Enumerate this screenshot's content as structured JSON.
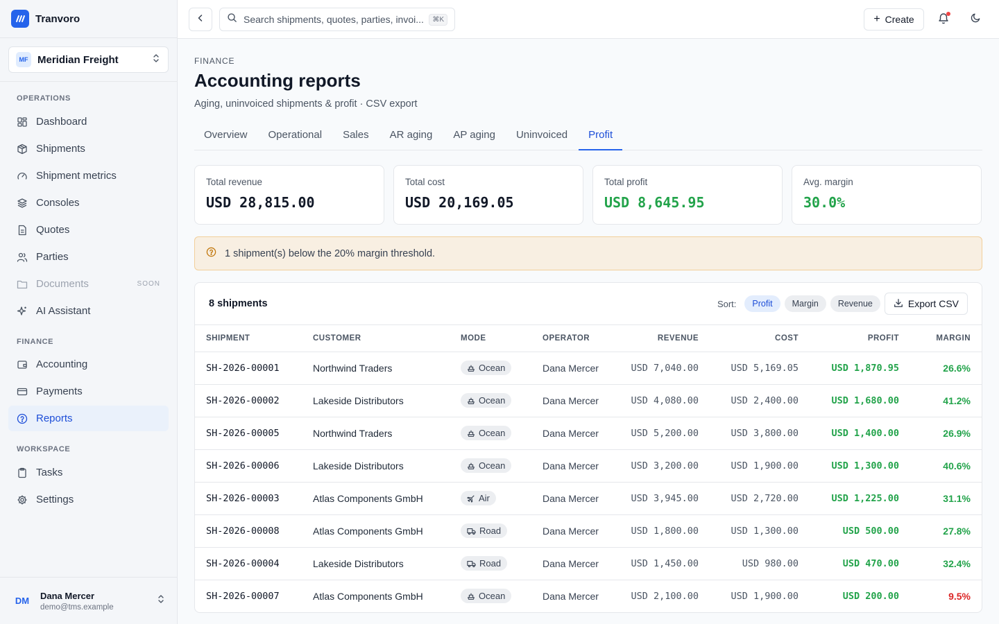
{
  "app": {
    "name": "Tranvoro"
  },
  "org": {
    "initials": "MF",
    "name": "Meridian Freight"
  },
  "sidebar": {
    "sections": [
      {
        "label": "OPERATIONS"
      },
      {
        "label": "FINANCE"
      },
      {
        "label": "WORKSPACE"
      }
    ],
    "items": [
      {
        "label": "Dashboard",
        "icon": "dashboard-icon"
      },
      {
        "label": "Shipments",
        "icon": "package-icon"
      },
      {
        "label": "Shipment metrics",
        "icon": "gauge-icon"
      },
      {
        "label": "Consoles",
        "icon": "layers-icon"
      },
      {
        "label": "Quotes",
        "icon": "document-icon"
      },
      {
        "label": "Parties",
        "icon": "users-icon"
      },
      {
        "label": "Documents",
        "icon": "folder-icon",
        "badge": "SOON"
      },
      {
        "label": "AI Assistant",
        "icon": "sparkles-icon"
      },
      {
        "label": "Accounting",
        "icon": "wallet-icon"
      },
      {
        "label": "Payments",
        "icon": "credit-card-icon"
      },
      {
        "label": "Reports",
        "icon": "help-circle-icon"
      },
      {
        "label": "Tasks",
        "icon": "clipboard-icon"
      },
      {
        "label": "Settings",
        "icon": "gear-icon"
      }
    ]
  },
  "user": {
    "initials": "DM",
    "name": "Dana Mercer",
    "email": "demo@tms.example"
  },
  "topbar": {
    "search_placeholder": "Search shipments, quotes, parties, invoi...",
    "search_shortcut": "⌘K",
    "create_label": "Create"
  },
  "page": {
    "eyebrow": "FINANCE",
    "title": "Accounting reports",
    "subtitle": "Aging, uninvoiced shipments & profit · CSV export",
    "tabs": [
      "Overview",
      "Operational",
      "Sales",
      "AR aging",
      "AP aging",
      "Uninvoiced",
      "Profit"
    ],
    "active_tab": "Profit"
  },
  "summary": [
    {
      "label": "Total revenue",
      "value": "USD 28,815.00"
    },
    {
      "label": "Total cost",
      "value": "USD 20,169.05"
    },
    {
      "label": "Total profit",
      "value": "USD 8,645.95"
    },
    {
      "label": "Avg. margin",
      "value": "30.0%"
    }
  ],
  "alert": {
    "text": "1 shipment(s) below the 20% margin threshold."
  },
  "table": {
    "count_label": "8 shipments",
    "sort_label": "Sort:",
    "sort_options": [
      "Profit",
      "Margin",
      "Revenue"
    ],
    "active_sort": "Profit",
    "export_label": "Export CSV",
    "columns": [
      "SHIPMENT",
      "CUSTOMER",
      "MODE",
      "OPERATOR",
      "REVENUE",
      "COST",
      "PROFIT",
      "MARGIN"
    ],
    "rows": [
      {
        "shipment": "SH-2026-00001",
        "customer": "Northwind Traders",
        "mode": "Ocean",
        "operator": "Dana Mercer",
        "revenue": "USD 7,040.00",
        "cost": "USD 5,169.05",
        "profit": "USD 1,870.95",
        "margin": "26.6%"
      },
      {
        "shipment": "SH-2026-00002",
        "customer": "Lakeside Distributors",
        "mode": "Ocean",
        "operator": "Dana Mercer",
        "revenue": "USD 4,080.00",
        "cost": "USD 2,400.00",
        "profit": "USD 1,680.00",
        "margin": "41.2%"
      },
      {
        "shipment": "SH-2026-00005",
        "customer": "Northwind Traders",
        "mode": "Ocean",
        "operator": "Dana Mercer",
        "revenue": "USD 5,200.00",
        "cost": "USD 3,800.00",
        "profit": "USD 1,400.00",
        "margin": "26.9%"
      },
      {
        "shipment": "SH-2026-00006",
        "customer": "Lakeside Distributors",
        "mode": "Ocean",
        "operator": "Dana Mercer",
        "revenue": "USD 3,200.00",
        "cost": "USD 1,900.00",
        "profit": "USD 1,300.00",
        "margin": "40.6%"
      },
      {
        "shipment": "SH-2026-00003",
        "customer": "Atlas Components GmbH",
        "mode": "Air",
        "operator": "Dana Mercer",
        "revenue": "USD 3,945.00",
        "cost": "USD 2,720.00",
        "profit": "USD 1,225.00",
        "margin": "31.1%"
      },
      {
        "shipment": "SH-2026-00008",
        "customer": "Atlas Components GmbH",
        "mode": "Road",
        "operator": "Dana Mercer",
        "revenue": "USD 1,800.00",
        "cost": "USD 1,300.00",
        "profit": "USD 500.00",
        "margin": "27.8%"
      },
      {
        "shipment": "SH-2026-00004",
        "customer": "Lakeside Distributors",
        "mode": "Road",
        "operator": "Dana Mercer",
        "revenue": "USD 1,450.00",
        "cost": "USD 980.00",
        "profit": "USD 470.00",
        "margin": "32.4%"
      },
      {
        "shipment": "SH-2026-00007",
        "customer": "Atlas Components GmbH",
        "mode": "Ocean",
        "operator": "Dana Mercer",
        "revenue": "USD 2,100.00",
        "cost": "USD 1,900.00",
        "profit": "USD 200.00",
        "margin": "9.5%"
      }
    ]
  },
  "colors": {
    "accent": "#2563eb",
    "positive": "#22a34a",
    "negative": "#dc2626",
    "warning_bg": "#f8efe2"
  }
}
